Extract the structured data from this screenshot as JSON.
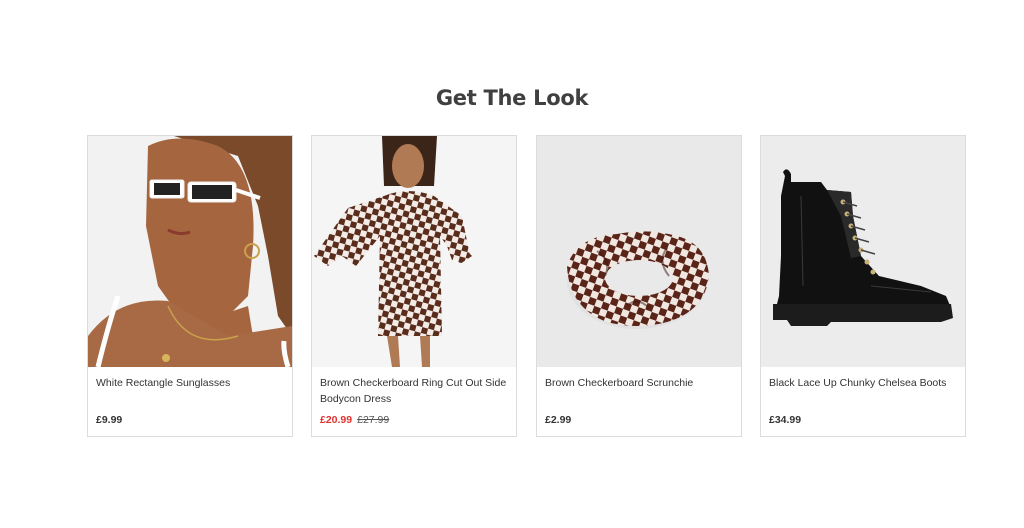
{
  "section": {
    "title": "Get The Look"
  },
  "products": [
    {
      "name": "White Rectangle Sunglasses",
      "price": "£9.99",
      "image": "model-wearing-white-sunglasses"
    },
    {
      "name": "Brown Checkerboard Ring Cut Out Side Bodycon Dress",
      "price": "£20.99",
      "was_price": "£27.99",
      "image": "model-in-checkerboard-dress"
    },
    {
      "name": "Brown Checkerboard Scrunchie",
      "price": "£2.99",
      "image": "checkerboard-scrunchie"
    },
    {
      "name": "Black Lace Up Chunky Chelsea Boots",
      "price": "£34.99",
      "image": "black-chelsea-boot"
    }
  ],
  "colors": {
    "sale": "#e0322f",
    "text": "#333333",
    "border": "#dcdcdc",
    "image_bg": "#ebebeb"
  }
}
